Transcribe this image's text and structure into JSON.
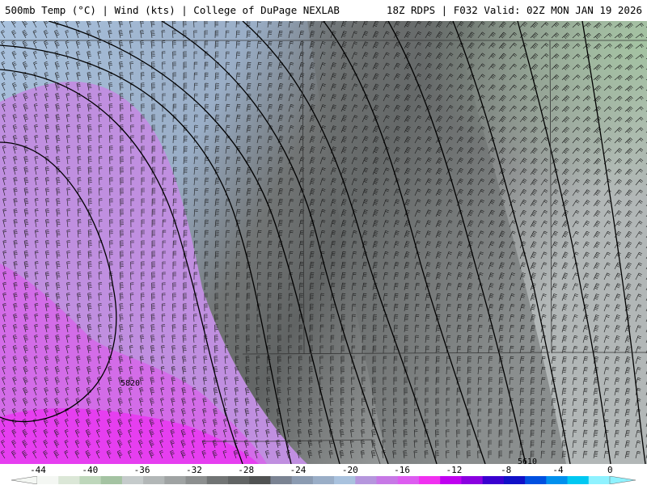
{
  "header": {
    "title_left": "500mb Temp (°C) | Wind (kts) | College of DuPage NEXLAB",
    "title_right": "18Z RDPS | F032 Valid: 02Z MON JAN 19 2026"
  },
  "map": {
    "height_contour_labels": [
      "5820",
      "5610"
    ]
  },
  "colorbar": {
    "tick_labels": [
      "-44",
      "-40",
      "-36",
      "-32",
      "-28",
      "-24",
      "-20",
      "-16",
      "-12",
      "-8",
      "-4",
      "0"
    ],
    "colors": [
      "#f4f7f3",
      "#dbe7d7",
      "#bed7bb",
      "#a4c3a2",
      "#c5cbcb",
      "#b2b7b7",
      "#9fa3a3",
      "#8c8f8f",
      "#717474",
      "#616464",
      "#505252",
      "#7a8392",
      "#8b9bb1",
      "#9aaec7",
      "#a9c2de",
      "#b596dd",
      "#c778e6",
      "#dd5cf0",
      "#f030f0",
      "#c000f0",
      "#8a00e0",
      "#3a00d0",
      "#1010c8",
      "#0050e0",
      "#0090ee",
      "#00c8f2",
      "#8ff2ff"
    ]
  }
}
